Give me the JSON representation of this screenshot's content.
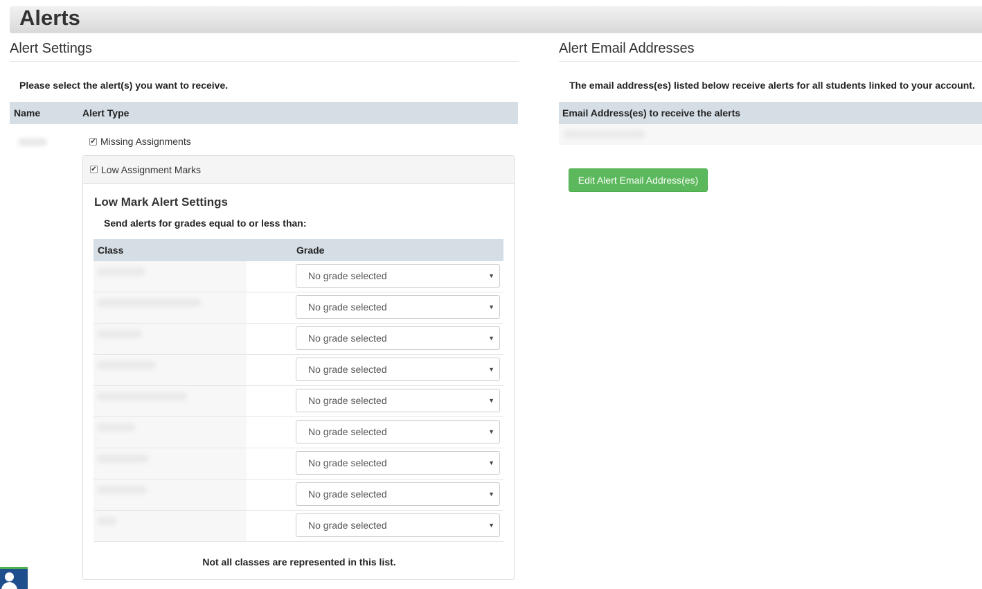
{
  "page": {
    "title": "Alerts"
  },
  "settings": {
    "title": "Alert Settings",
    "instructions": "Please select the alert(s) you want to receive.",
    "columns": {
      "name": "Name",
      "alert_type": "Alert Type"
    },
    "student_name": "",
    "alerts": [
      {
        "label": "Missing Assignments",
        "checked": true
      },
      {
        "label": "Low Assignment Marks",
        "checked": true
      }
    ]
  },
  "low_mark": {
    "title": "Low Mark Alert Settings",
    "subtitle": "Send alerts for grades equal to or less than:",
    "columns": {
      "class": "Class",
      "grade": "Grade"
    },
    "rows": [
      {
        "class": "",
        "grade": "No grade selected"
      },
      {
        "class": "",
        "grade": "No grade selected"
      },
      {
        "class": "",
        "grade": "No grade selected"
      },
      {
        "class": "",
        "grade": "No grade selected"
      },
      {
        "class": "",
        "grade": "No grade selected"
      },
      {
        "class": "",
        "grade": "No grade selected"
      },
      {
        "class": "",
        "grade": "No grade selected"
      },
      {
        "class": "",
        "grade": "No grade selected"
      },
      {
        "class": "",
        "grade": "No grade selected"
      }
    ],
    "note": "Not all classes are represented in this list."
  },
  "emails": {
    "title": "Alert Email Addresses",
    "instructions": "The email address(es) listed below receive alerts for all students linked to your account.",
    "column": "Email Address(es) to receive the alerts",
    "address": "",
    "edit_button": "Edit Alert Email Address(es)"
  },
  "colors": {
    "header_bar": "#d5dee5",
    "button_green": "#5cb85c",
    "chat_widget": "#1e4e8c"
  }
}
